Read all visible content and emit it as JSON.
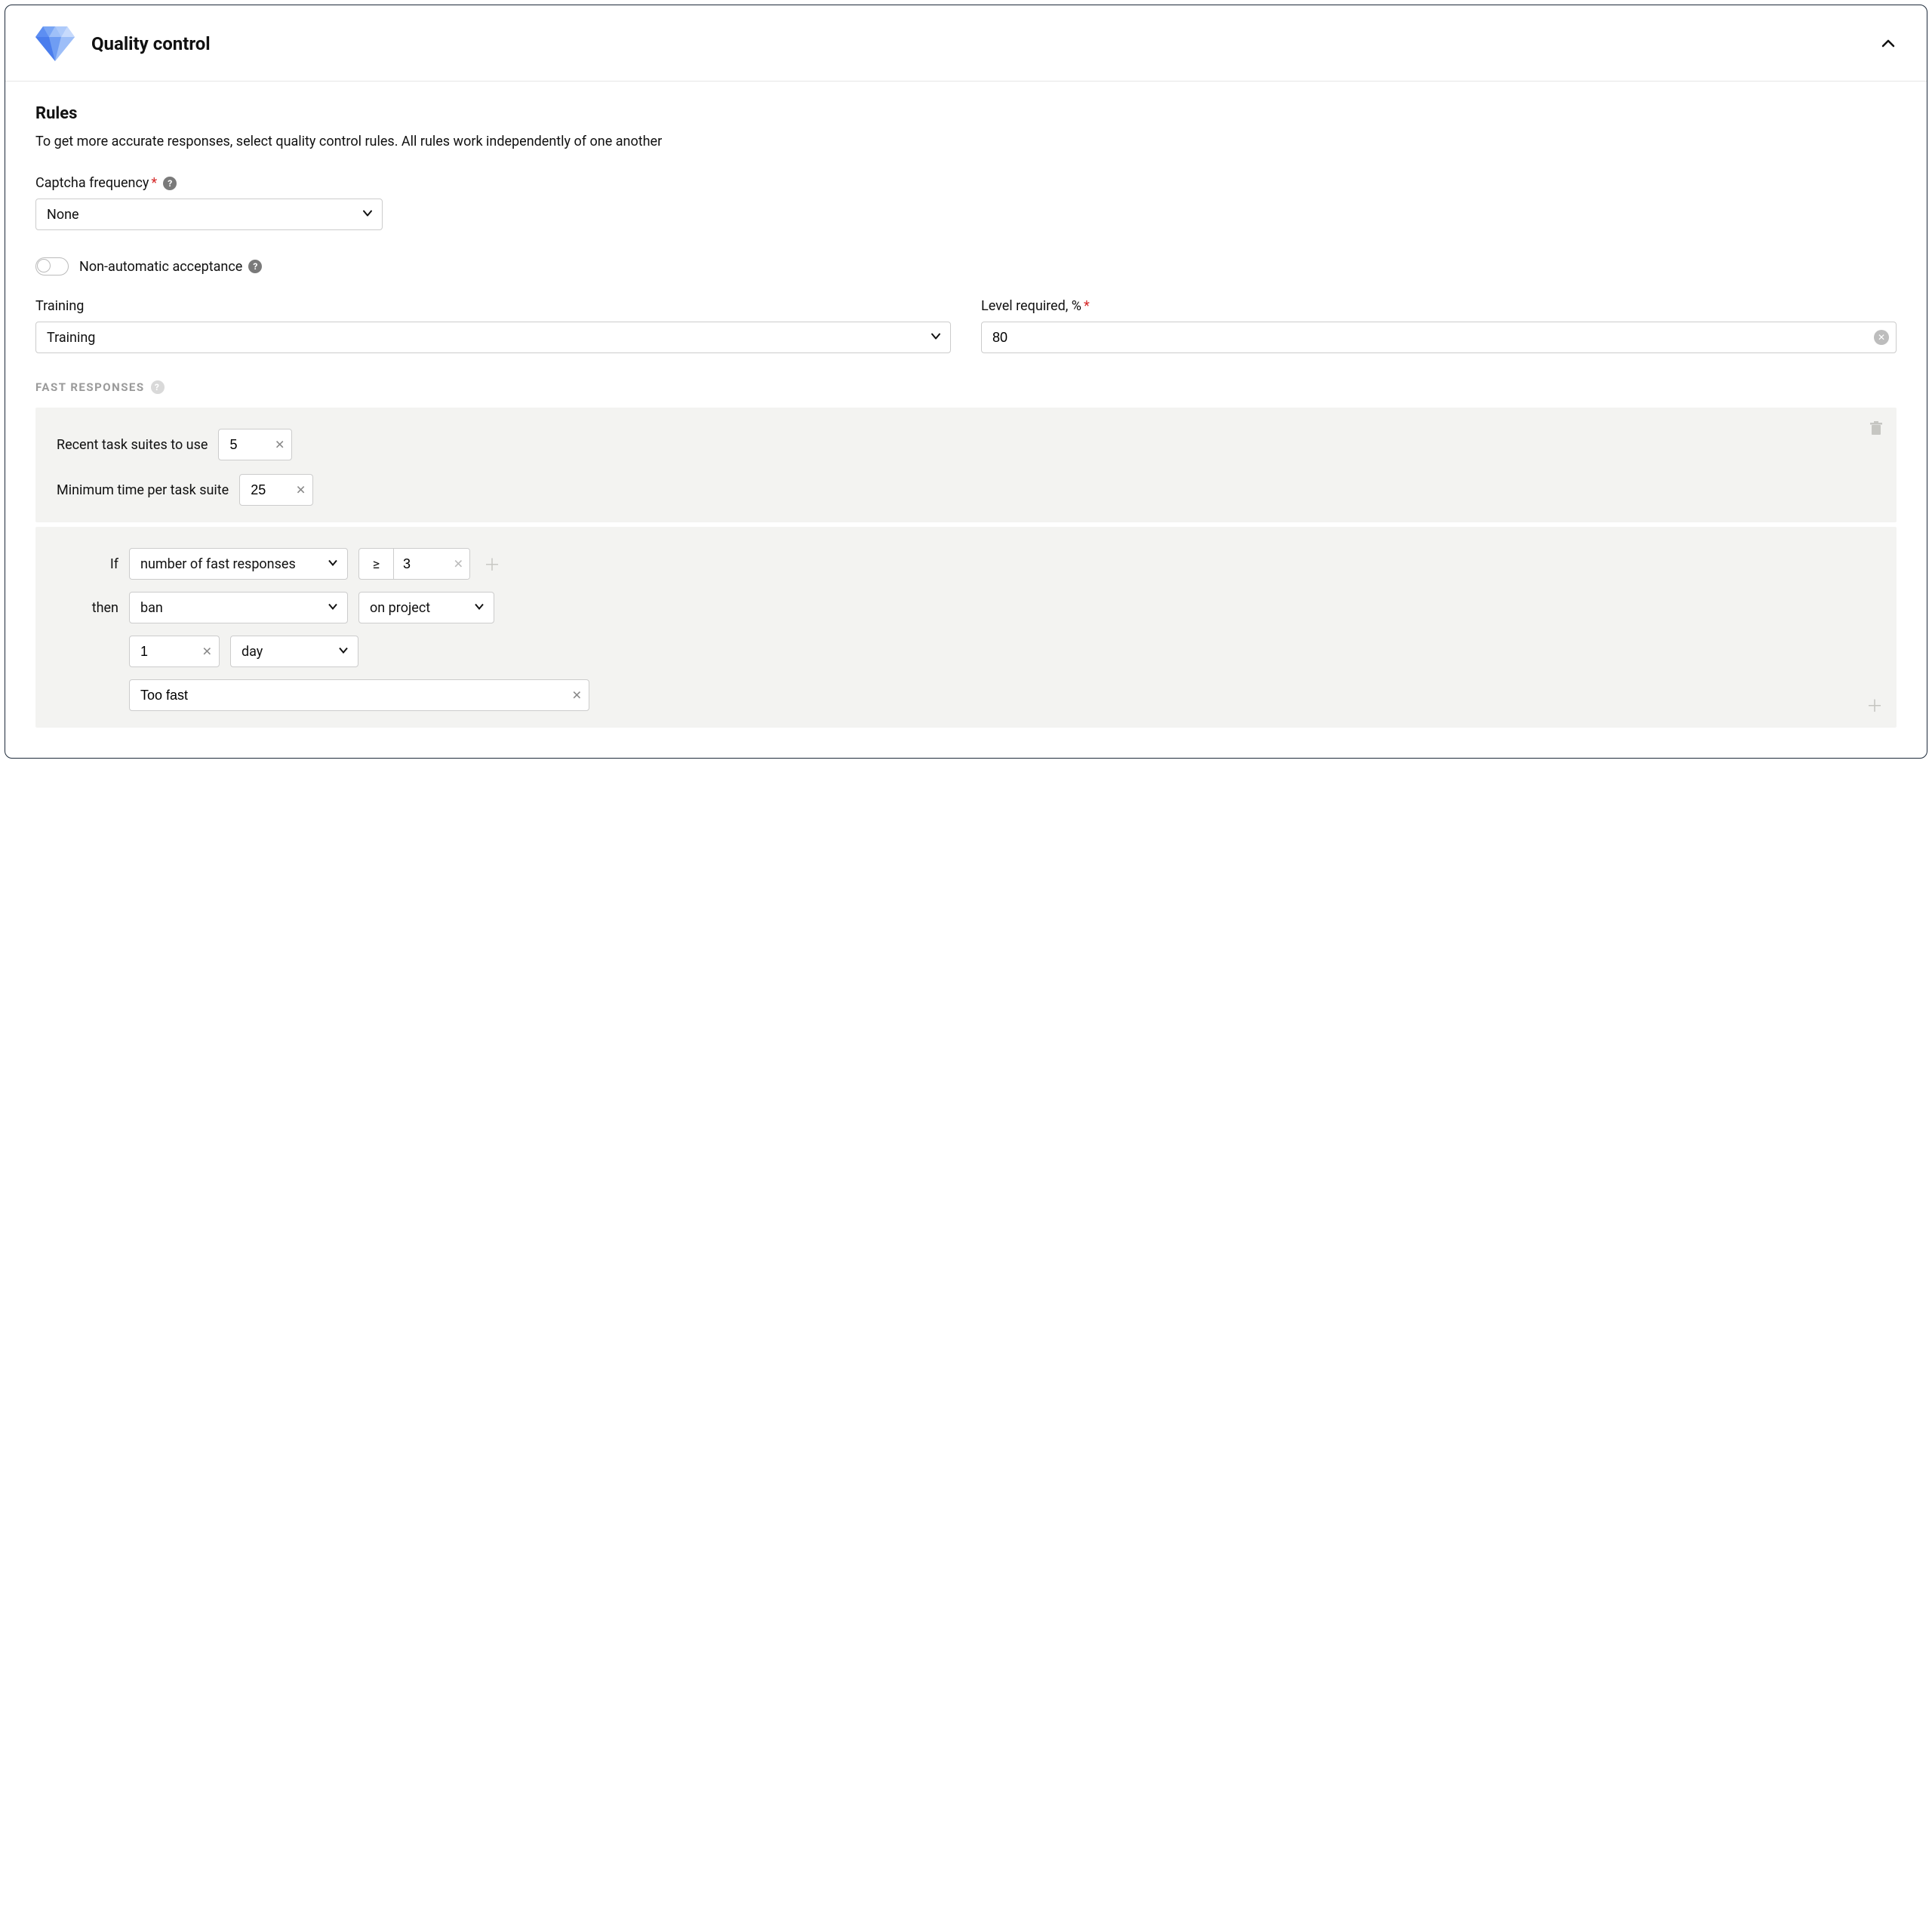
{
  "header": {
    "title": "Quality control"
  },
  "rules": {
    "title": "Rules",
    "desc": "To get more accurate responses, select quality control rules. All rules work independently of one another"
  },
  "captcha": {
    "label": "Captcha frequency",
    "value": "None"
  },
  "nonauto": {
    "label": "Non-automatic acceptance"
  },
  "training": {
    "label": "Training",
    "value": "Training"
  },
  "level": {
    "label": "Level required, %",
    "value": "80"
  },
  "fast": {
    "header": "FAST RESPONSES",
    "recent_label": "Recent task suites to use",
    "recent_value": "5",
    "min_time_label": "Minimum time per task suite",
    "min_time_value": "25",
    "if_label": "If",
    "then_label": "then",
    "cond_metric": "number of fast responses",
    "cond_op": "≥",
    "cond_value": "3",
    "action": "ban",
    "scope": "on project",
    "duration_value": "1",
    "duration_unit": "day",
    "reason": "Too fast"
  }
}
